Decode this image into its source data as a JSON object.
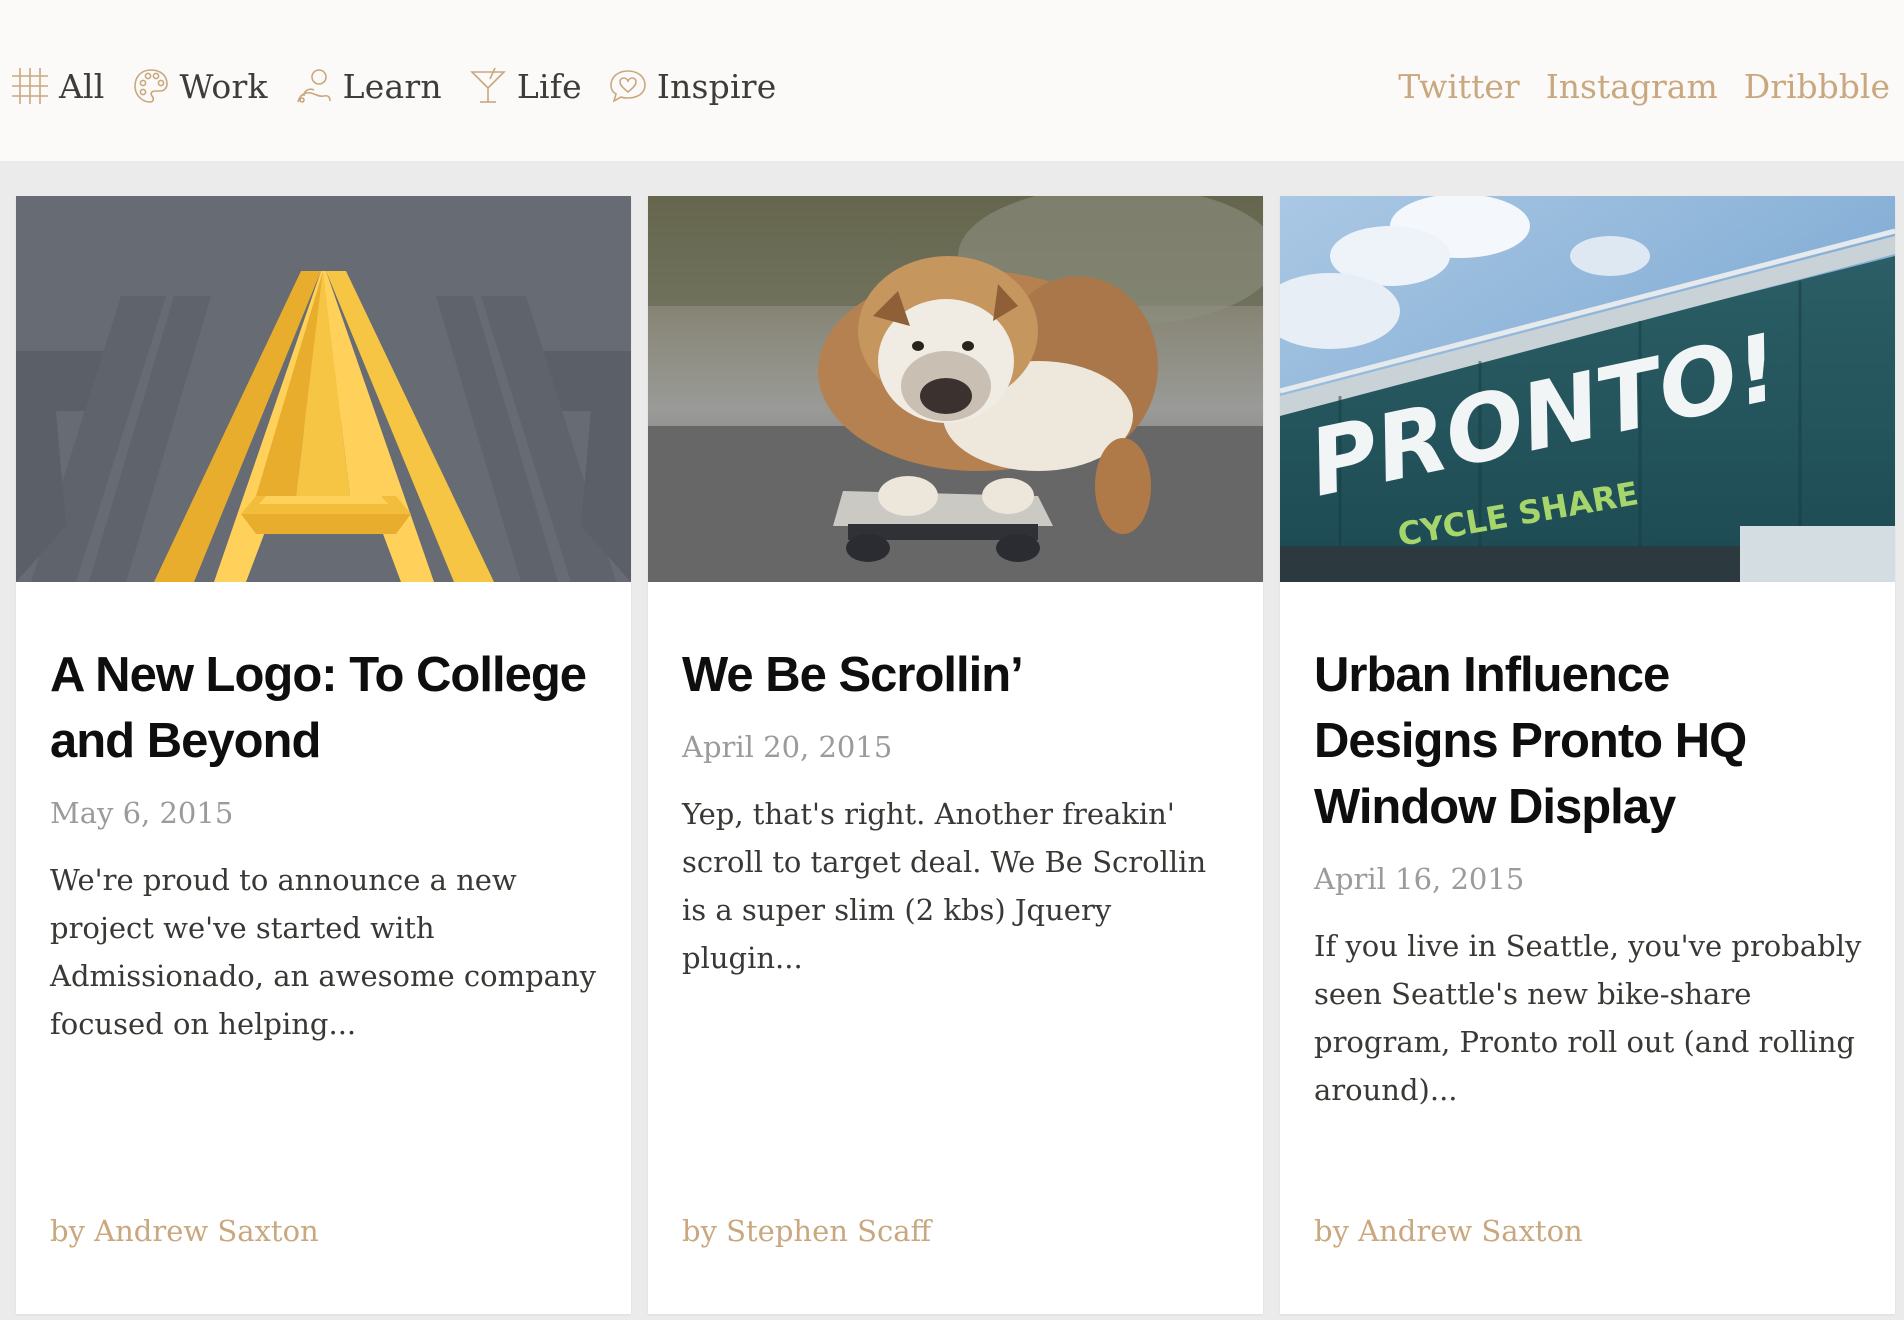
{
  "nav": {
    "items": [
      {
        "label": "All",
        "icon": "grid-icon"
      },
      {
        "label": "Work",
        "icon": "palette-icon"
      },
      {
        "label": "Learn",
        "icon": "baby-icon"
      },
      {
        "label": "Life",
        "icon": "cocktail-icon"
      },
      {
        "label": "Inspire",
        "icon": "heart-bubble-icon"
      }
    ]
  },
  "social": {
    "twitter": "Twitter",
    "instagram": "Instagram",
    "dribbble": "Dribbble"
  },
  "colors": {
    "accent": "#c9a87f",
    "text": "#3f3b38",
    "background": "#ebebeb",
    "header": "#fbfaf8"
  },
  "cards": [
    {
      "title": "A New Logo: To College and Beyond",
      "date": "May 6, 2015",
      "excerpt": "We're proud to announce a new project we've started with Admissionado, an awesome company focused on helping...",
      "author": "by Andrew Saxton"
    },
    {
      "title": "We Be Scrollin’",
      "date": "April 20, 2015",
      "excerpt": "Yep, that's right. Another freakin' scroll to target deal. We Be Scrollin is a super slim (2 kbs) Jquery plugin...",
      "author": "by Stephen Scaff"
    },
    {
      "title": "Urban Influence Designs Pronto HQ Window Display",
      "date": "April 16, 2015",
      "excerpt": "If you live in Seattle, you've probably seen Seattle's new bike-share program, Pronto roll out (and rolling around)...",
      "author": "by Andrew Saxton",
      "image_text": {
        "main": "PRONTO!",
        "sub": "CYCLE SHARE"
      }
    }
  ]
}
